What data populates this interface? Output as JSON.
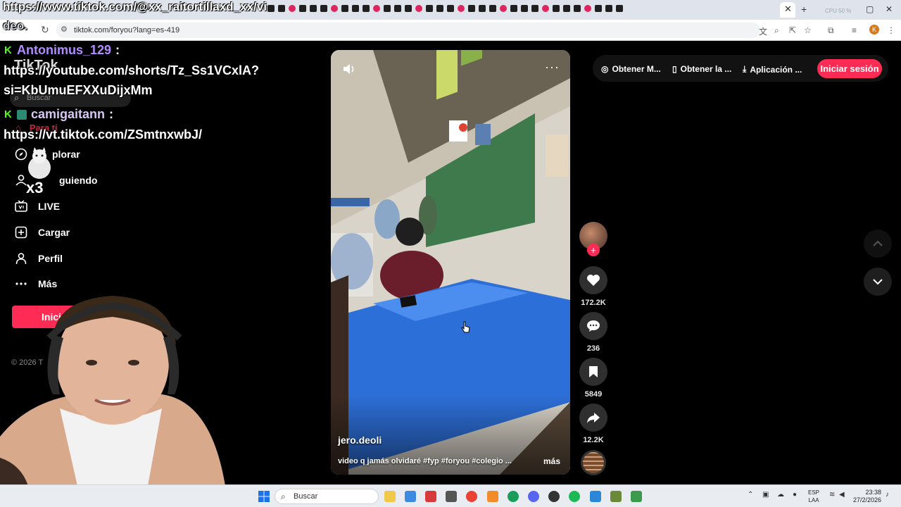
{
  "overlay": {
    "top_url": "https://www.tiktok.com/@xx_raitortillaxd_xx/vi",
    "top_url_cont": "deo.",
    "messages": [
      {
        "user": "Antonimus_129",
        "sep": ":",
        "text1": "https://youtube.com/shorts/Tz_Ss1VCxlA?",
        "text2": "si=KbUmuEFXXuDijxMm"
      },
      {
        "user": "camigaitann",
        "sep": ":",
        "text1": "https://vt.tiktok.com/ZSmtnxwbJ/"
      }
    ],
    "cat_label": "x3"
  },
  "browser": {
    "url": "tiktok.com/foryou?lang=es-419",
    "active_tab_close": "✕",
    "new_tab": "+",
    "cpu_label": "CPU",
    "cpu_value": "50 %",
    "profile_initial": "K"
  },
  "sidebar": {
    "logo": "TikTok",
    "search_placeholder": "Buscar",
    "items": [
      {
        "label": "Para ti"
      },
      {
        "label": "Explorar"
      },
      {
        "label": "Siguiendo"
      },
      {
        "label": "LIVE"
      },
      {
        "label": "Cargar"
      },
      {
        "label": "Perfil"
      },
      {
        "label": "Más"
      }
    ],
    "visible_labels": {
      "para_ti": "Para ti",
      "explorar": "plorar",
      "siguiendo": "guiendo"
    },
    "login_button": "Inicia",
    "copyright": "© 2026 T"
  },
  "video": {
    "author": "jero.deoli",
    "caption": "video q jamás olvidaré #fyp #foryou #colegio ...",
    "more": "más",
    "menu": "···"
  },
  "actions": {
    "likes": "172.2K",
    "comments": "236",
    "saves": "5849",
    "shares": "12.2K"
  },
  "top_right": {
    "item1": "Obtener M...",
    "item2": "Obtener la ...",
    "item3": "Aplicación ...",
    "login": "Iniciar sesión"
  },
  "taskbar": {
    "search_placeholder": "Buscar",
    "lang_top": "ESP",
    "lang_bottom": "LAA",
    "time": "23:38",
    "date": "27/2/2026"
  },
  "colors": {
    "brand_pink": "#fe2c55",
    "kick_green": "#53fc18",
    "chat_name_purple": "#b18cff",
    "chat_name_lilac": "#d7c7f2"
  }
}
